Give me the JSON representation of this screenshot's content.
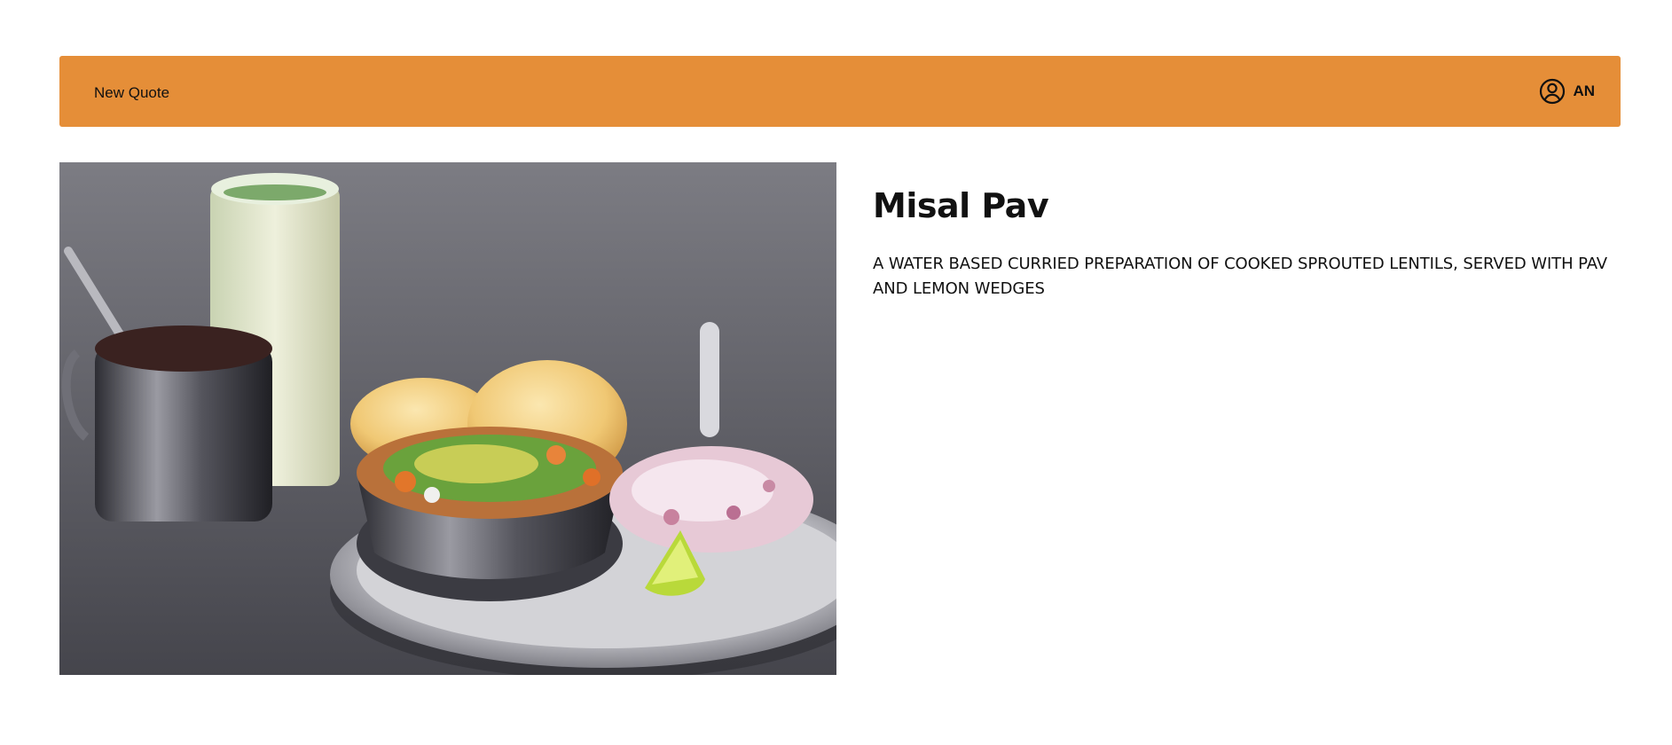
{
  "navbar": {
    "link_label": "New Quote",
    "user_initials": "AN",
    "user_icon": "user-circle-icon",
    "background_color": "#e58e38"
  },
  "dish": {
    "title": "Misal Pav",
    "description": "A WATER BASED CURRIED PREPARATION OF COOKED SPROUTED LENTILS, SERVED WITH PAV AND LEMON WEDGES",
    "image_alt": "Misal Pav"
  }
}
